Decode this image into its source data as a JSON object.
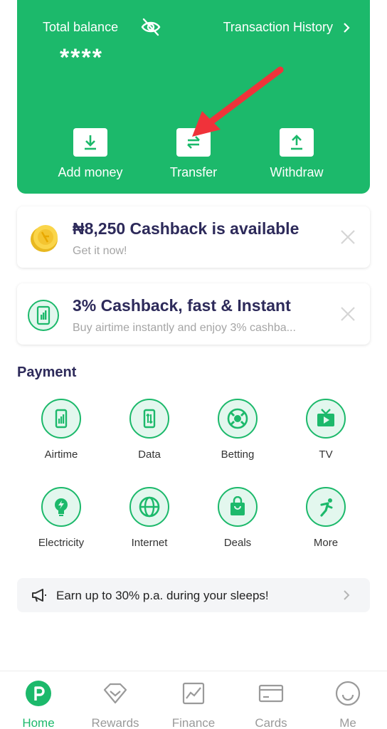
{
  "balance_card": {
    "label": "Total balance",
    "value": "****",
    "history_label": "Transaction History",
    "actions": [
      {
        "label": "Add money",
        "icon": "download-icon"
      },
      {
        "label": "Transfer",
        "icon": "transfer-icon"
      },
      {
        "label": "Withdraw",
        "icon": "upload-icon"
      }
    ]
  },
  "promos": [
    {
      "title": "₦8,250 Cashback is available",
      "subtitle": "Get it now!",
      "icon": "coin-icon"
    },
    {
      "title": "3% Cashback, fast & Instant",
      "subtitle": "Buy airtime instantly and enjoy 3% cashba...",
      "icon": "phone-icon"
    }
  ],
  "payment": {
    "title": "Payment",
    "items": [
      {
        "label": "Airtime",
        "icon": "phone-icon"
      },
      {
        "label": "Data",
        "icon": "data-icon"
      },
      {
        "label": "Betting",
        "icon": "ball-icon"
      },
      {
        "label": "TV",
        "icon": "tv-icon"
      },
      {
        "label": "Electricity",
        "icon": "bulb-icon"
      },
      {
        "label": "Internet",
        "icon": "globe-icon"
      },
      {
        "label": "Deals",
        "icon": "bag-icon"
      },
      {
        "label": "More",
        "icon": "more-icon"
      }
    ]
  },
  "earn_banner": {
    "text": "Earn up to 30% p.a. during your sleeps!",
    "icon": "megaphone-icon"
  },
  "bottom_nav": [
    {
      "label": "Home",
      "icon": "home-icon",
      "active": true
    },
    {
      "label": "Rewards",
      "icon": "rewards-icon"
    },
    {
      "label": "Finance",
      "icon": "finance-icon"
    },
    {
      "label": "Cards",
      "icon": "cards-icon"
    },
    {
      "label": "Me",
      "icon": "me-icon"
    }
  ],
  "colors": {
    "brand_green": "#1cb96b",
    "title_navy": "#2d2a5a",
    "annotation_red": "#f0323a"
  }
}
